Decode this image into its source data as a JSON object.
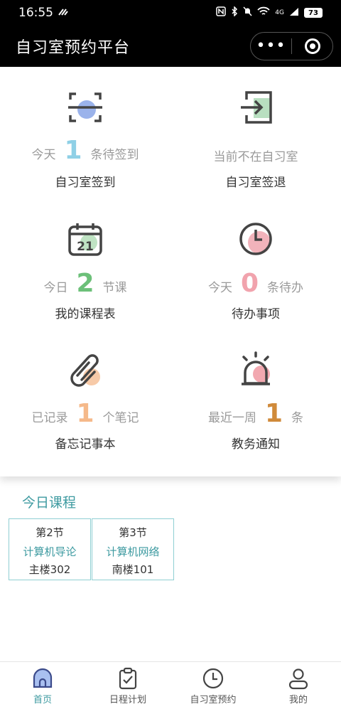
{
  "status_bar": {
    "time": "16:55",
    "network": "4G",
    "battery": "73"
  },
  "header": {
    "title": "自习室预约平台",
    "more_icon": "•••"
  },
  "grid": [
    {
      "icon": "scan-checkin-icon",
      "prefix": "今天",
      "num": "1",
      "suffix": "条待签到",
      "num_color": "#8fd0e6",
      "title": "自习室签到"
    },
    {
      "icon": "checkout-exit-icon",
      "prefix": "当前不在自习室",
      "num": "",
      "suffix": "",
      "num_color": "#999999",
      "title": "自习室签退"
    },
    {
      "icon": "calendar-21-icon",
      "prefix": "今日",
      "num": "2",
      "suffix": "节课",
      "num_color": "#6cc079",
      "title": "我的课程表"
    },
    {
      "icon": "clock-icon",
      "prefix": "今天",
      "num": "0",
      "suffix": "条待办",
      "num_color": "#f1a3ad",
      "title": "待办事项"
    },
    {
      "icon": "paperclip-icon",
      "prefix": "已记录",
      "num": "1",
      "suffix": "个笔记",
      "num_color": "#f5b98a",
      "title": "备忘记事本"
    },
    {
      "icon": "alarm-notice-icon",
      "prefix": "最近一周",
      "num": "1",
      "suffix": "条",
      "num_color": "#d08a3a",
      "title": "教务通知"
    }
  ],
  "today": {
    "title": "今日课程",
    "courses": [
      {
        "period": "第2节",
        "name": "计算机导论",
        "room": "主楼302"
      },
      {
        "period": "第3节",
        "name": "计算机网络",
        "room": "南楼101"
      }
    ]
  },
  "tabbar": [
    {
      "label": "首页",
      "icon": "home-icon",
      "active": true
    },
    {
      "label": "日程计划",
      "icon": "clipboard-check-icon",
      "active": false
    },
    {
      "label": "自习室预约",
      "icon": "clock-icon",
      "active": false
    },
    {
      "label": "我的",
      "icon": "user-icon",
      "active": false
    }
  ],
  "colors": {
    "accent": "#3d9aa0",
    "header_bg": "#000000"
  }
}
